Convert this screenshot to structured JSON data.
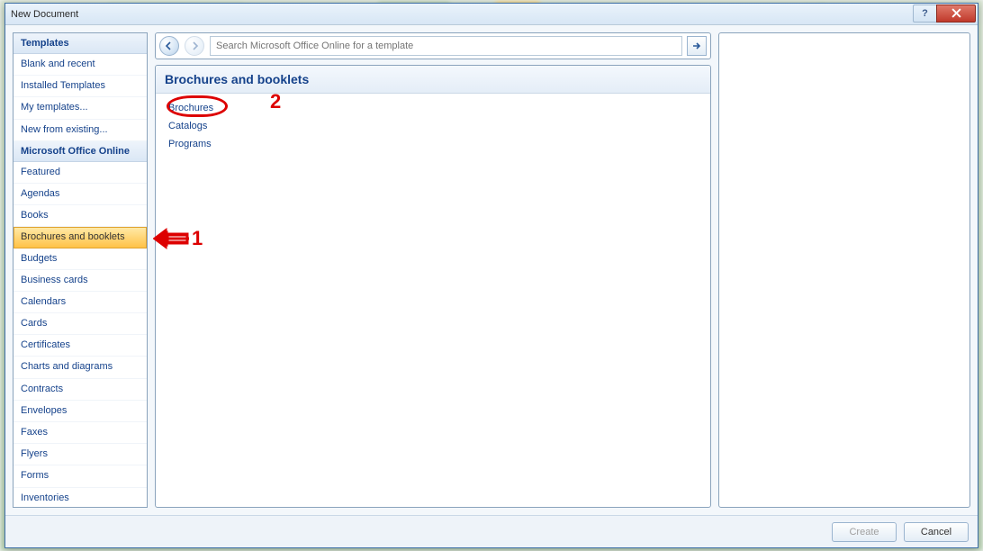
{
  "title": "New Document",
  "sidebar": {
    "header1": "Templates",
    "items_top": [
      "Blank and recent",
      "Installed Templates",
      "My templates...",
      "New from existing..."
    ],
    "header2": "Microsoft Office Online",
    "items_online": [
      "Featured",
      "Agendas",
      "Books",
      "Brochures and booklets",
      "Budgets",
      "Business cards",
      "Calendars",
      "Cards",
      "Certificates",
      "Charts and diagrams",
      "Contracts",
      "Envelopes",
      "Faxes",
      "Flyers",
      "Forms",
      "Inventories"
    ],
    "selected_index": 3
  },
  "search": {
    "placeholder": "Search Microsoft Office Online for a template"
  },
  "content": {
    "heading": "Brochures and booklets",
    "links": [
      "Brochures",
      "Catalogs",
      "Programs"
    ]
  },
  "footer": {
    "create": "Create",
    "cancel": "Cancel"
  },
  "annotations": {
    "label1": "1",
    "label2": "2"
  }
}
